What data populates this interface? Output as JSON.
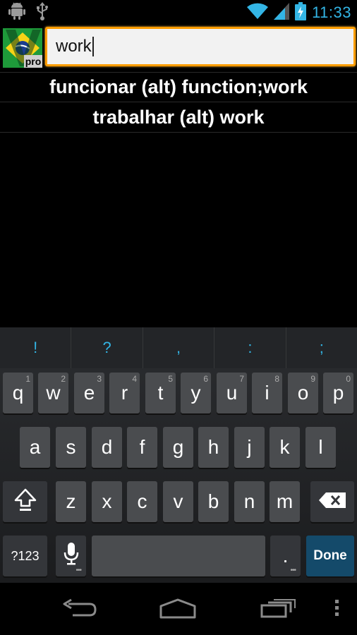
{
  "status": {
    "time": "11:33",
    "icons": [
      "android-debug-icon",
      "usb-icon",
      "wifi-icon",
      "cell-signal-icon",
      "battery-charging-icon"
    ]
  },
  "app": {
    "icon": "brazil-flag-v-pro-icon",
    "icon_badge": "pro"
  },
  "search": {
    "value": "work",
    "accent": "#ff9d00"
  },
  "results": [
    {
      "text": "funcionar (alt) function;work"
    },
    {
      "text": "trabalhar (alt) work"
    }
  ],
  "keyboard": {
    "suggestions": [
      "!",
      "?",
      ",",
      ":",
      ";"
    ],
    "row1": [
      {
        "key": "q",
        "hint": "1"
      },
      {
        "key": "w",
        "hint": "2"
      },
      {
        "key": "e",
        "hint": "3"
      },
      {
        "key": "r",
        "hint": "4"
      },
      {
        "key": "t",
        "hint": "5"
      },
      {
        "key": "y",
        "hint": "6"
      },
      {
        "key": "u",
        "hint": "7"
      },
      {
        "key": "i",
        "hint": "8"
      },
      {
        "key": "o",
        "hint": "9"
      },
      {
        "key": "p",
        "hint": "0"
      }
    ],
    "row2": [
      "a",
      "s",
      "d",
      "f",
      "g",
      "h",
      "j",
      "k",
      "l"
    ],
    "row3": [
      "z",
      "x",
      "c",
      "v",
      "b",
      "n",
      "m"
    ],
    "symbols_label": "?123",
    "period_label": ".",
    "done_label": "Done",
    "accent": "#33b5e5"
  }
}
